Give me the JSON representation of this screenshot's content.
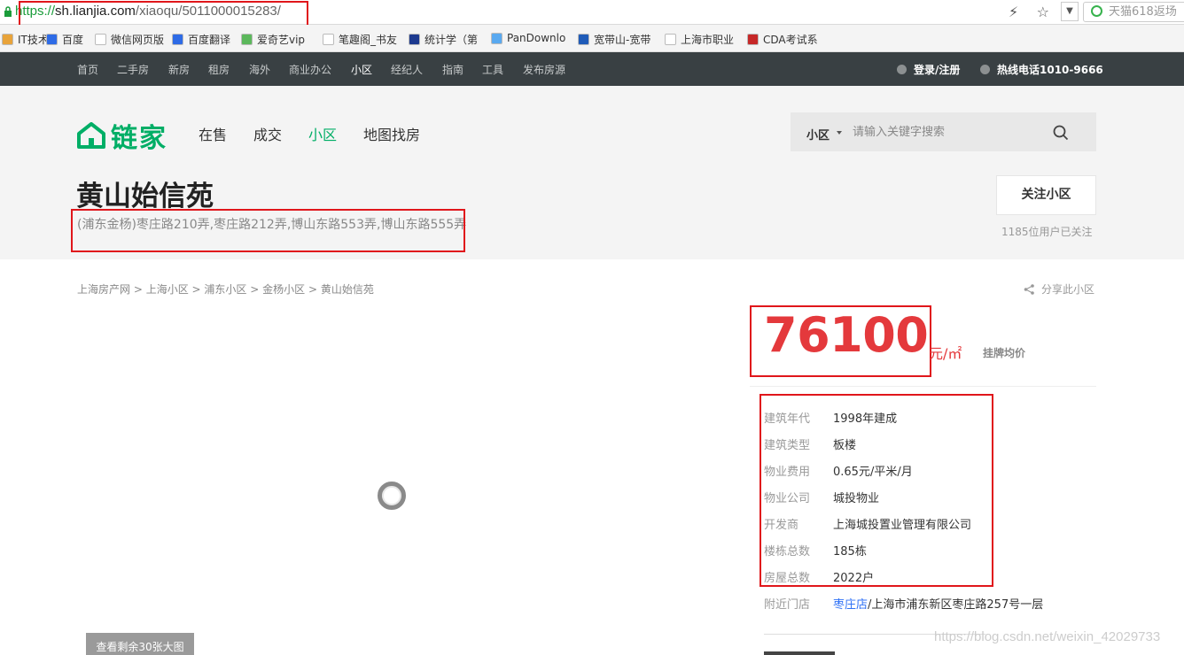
{
  "browser": {
    "url_scheme": "https://",
    "url_host": "sh.lianjia.com",
    "url_path": "/xiaoqu/5011000015283/",
    "search_placeholder": "天猫618返场",
    "bookmarks": [
      {
        "label": "IT技术",
        "color": "#e8a33a"
      },
      {
        "label": "百度",
        "color": "#2e6be6"
      },
      {
        "label": "微信网页版",
        "color": "#ffffff"
      },
      {
        "label": "百度翻译",
        "color": "#2e6be6"
      },
      {
        "label": "爱奇艺vip",
        "color": "#5cb85c"
      },
      {
        "label": "笔趣阁_书友",
        "color": "#ffffff"
      },
      {
        "label": "统计学（第",
        "color": "#1d3a8f"
      },
      {
        "label": "PanDownlo",
        "color": "#59a9f0"
      },
      {
        "label": "宽带山-宽带",
        "color": "#1f5bb8"
      },
      {
        "label": "上海市职业",
        "color": "#ffffff"
      },
      {
        "label": "CDA考试系",
        "color": "#c62828"
      }
    ]
  },
  "nav": {
    "items": [
      "首页",
      "二手房",
      "新房",
      "租房",
      "海外",
      "商业办公",
      "小区",
      "经纪人",
      "指南",
      "工具",
      "发布房源"
    ],
    "active": "小区",
    "login": "登录/注册",
    "hotline": "热线电话1010-9666"
  },
  "header": {
    "logo_text": "链家",
    "tabs": [
      "在售",
      "成交",
      "小区",
      "地图找房"
    ],
    "active_tab": "小区",
    "search_type": "小区",
    "search_placeholder": "请输入关键字搜索",
    "title": "黄山始信苑",
    "address": "(浦东金杨)枣庄路210弄,枣庄路212弄,博山东路553弄,博山东路555弄",
    "follow_label": "关注小区",
    "follow_count": "1185位用户已关注"
  },
  "breadcrumb": [
    "上海房产网",
    "上海小区",
    "浦东小区",
    "金杨小区",
    "黄山始信苑"
  ],
  "share_label": "分享此小区",
  "more_photos": "查看剩余30张大图",
  "price": {
    "value": "76100",
    "unit": "元/㎡",
    "label": "挂牌均价"
  },
  "info": [
    {
      "label": "建筑年代",
      "value": "1998年建成"
    },
    {
      "label": "建筑类型",
      "value": "板楼"
    },
    {
      "label": "物业费用",
      "value": "0.65元/平米/月"
    },
    {
      "label": "物业公司",
      "value": "城投物业"
    },
    {
      "label": "开发商",
      "value": "上海城投置业管理有限公司"
    },
    {
      "label": "楼栋总数",
      "value": "185栋"
    },
    {
      "label": "房屋总数",
      "value": "2022户"
    }
  ],
  "nearby": {
    "label": "附近门店",
    "store": "枣庄店",
    "address": "/上海市浦东新区枣庄路257号一层"
  },
  "watermark": "https://blog.csdn.net/weixin_42029733",
  "colors": {
    "brand": "#00ae66",
    "price": "#e4393c",
    "link": "#3072f6",
    "annotation": "#e0161b"
  }
}
